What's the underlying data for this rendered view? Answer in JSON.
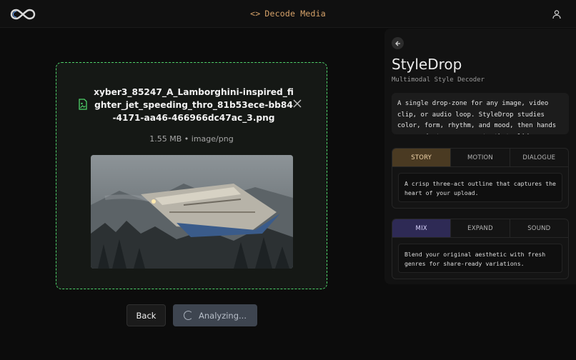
{
  "header": {
    "title_icon": "code-brackets-icon",
    "title": "Decode Media",
    "logo": "infinity-icon",
    "user_icon": "user-icon"
  },
  "upload": {
    "file_name": "xyber3_85247_A_Lamborghini-inspired_fighter_jet_speeding_thro_81b53ece-bb84-4171-aa46-466966dc47ac_3.png",
    "file_meta": "1.55 MB • image/png",
    "file_icon": "image-file-icon",
    "close_icon": "close-icon"
  },
  "actions": {
    "back_label": "Back",
    "analyze_label": "Analyzing..."
  },
  "panel": {
    "brand": "StyleDrop",
    "subtitle": "Multimodal Style Decoder",
    "description": "A single drop-zone for any image, video clip, or audio loop. StyleDrop studies color, form, rhythm, and mood, then hands you ready-to-use prompts that glide across",
    "group1": {
      "tabs": [
        "STORY",
        "MOTION",
        "DIALOGUE"
      ],
      "active": "STORY",
      "body": "A crisp three-act outline that captures the heart of your upload."
    },
    "group2": {
      "tabs": [
        "MIX",
        "EXPAND",
        "SOUND"
      ],
      "active": "MIX",
      "body": "Blend your original aesthetic with fresh genres for share-ready variations."
    }
  },
  "colors": {
    "accent_orange": "#d7a36a",
    "dropzone_border": "#4ed36b",
    "story_active": "#4a3a22",
    "mix_active": "#2e2a55"
  }
}
